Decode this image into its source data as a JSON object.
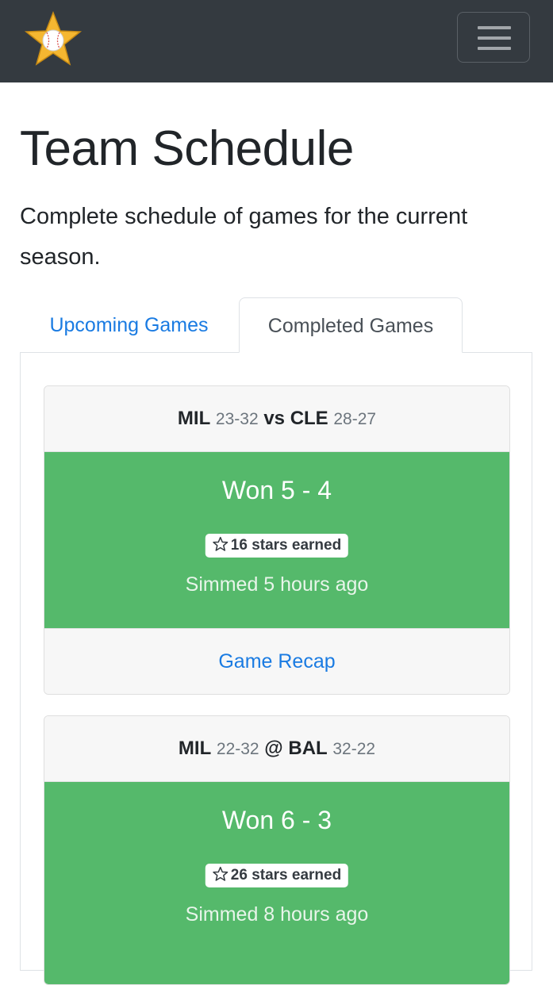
{
  "header": {
    "logo_icon": "baseball-star-icon",
    "menu_icon": "hamburger-menu-icon"
  },
  "page": {
    "title": "Team Schedule",
    "lead": "Complete schedule of games for the current season."
  },
  "tabs": [
    {
      "label": "Upcoming Games",
      "active": false
    },
    {
      "label": "Completed Games",
      "active": true
    }
  ],
  "games": [
    {
      "home_team": "MIL",
      "home_record": "23-32",
      "separator": "vs",
      "away_team": "CLE",
      "away_record": "28-27",
      "result": "Won 5 - 4",
      "stars": "16 stars earned",
      "simmed": "Simmed 5 hours ago",
      "recap_label": "Game Recap"
    },
    {
      "home_team": "MIL",
      "home_record": "22-32",
      "separator": "@",
      "away_team": "BAL",
      "away_record": "32-22",
      "result": "Won 6 - 3",
      "stars": "26 stars earned",
      "simmed": "Simmed 8 hours ago"
    }
  ],
  "colors": {
    "navbar": "#343a40",
    "win": "#55b96b",
    "link": "#1a7be2"
  }
}
